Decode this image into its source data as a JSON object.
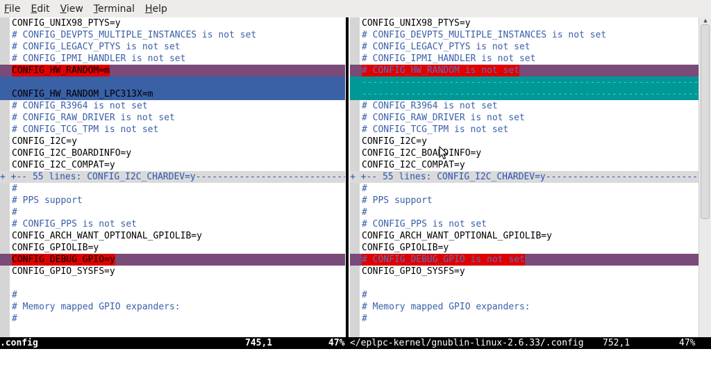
{
  "menubar": {
    "items": [
      {
        "accel": "F",
        "rest": "ile"
      },
      {
        "accel": "E",
        "rest": "dit"
      },
      {
        "accel": "V",
        "rest": "iew"
      },
      {
        "accel": "T",
        "rest": "erminal"
      },
      {
        "accel": "H",
        "rest": "elp"
      }
    ]
  },
  "left": {
    "lines": [
      {
        "text": "CONFIG_UNIX98_PTYS=y",
        "kind": "normal"
      },
      {
        "text": "# CONFIG_DEVPTS_MULTIPLE_INSTANCES is not set",
        "kind": "comment"
      },
      {
        "text": "# CONFIG_LEGACY_PTYS is not set",
        "kind": "comment"
      },
      {
        "text": "# CONFIG_IPMI_HANDLER is not set",
        "kind": "comment"
      },
      {
        "text": "CONFIG_HW_RANDOM=m",
        "kind": "change"
      },
      {
        "text": "",
        "kind": "add"
      },
      {
        "text": "CONFIG_HW_RANDOM_LPC313X=m",
        "kind": "add"
      },
      {
        "text": "# CONFIG_R3964 is not set",
        "kind": "comment"
      },
      {
        "text": "# CONFIG_RAW_DRIVER is not set",
        "kind": "comment"
      },
      {
        "text": "# CONFIG_TCG_TPM is not set",
        "kind": "comment"
      },
      {
        "text": "CONFIG_I2C=y",
        "kind": "normal"
      },
      {
        "text": "CONFIG_I2C_BOARDINFO=y",
        "kind": "normal"
      },
      {
        "text": "CONFIG_I2C_COMPAT=y",
        "kind": "normal"
      },
      {
        "text": "+ +-- 55 lines: CONFIG_I2C_CHARDEV=y---------------------------------",
        "kind": "fold"
      },
      {
        "text": "#",
        "kind": "comment"
      },
      {
        "text": "# PPS support",
        "kind": "comment"
      },
      {
        "text": "#",
        "kind": "comment"
      },
      {
        "text": "# CONFIG_PPS is not set",
        "kind": "comment"
      },
      {
        "text": "CONFIG_ARCH_WANT_OPTIONAL_GPIOLIB=y",
        "kind": "normal"
      },
      {
        "text": "CONFIG_GPIOLIB=y",
        "kind": "normal"
      },
      {
        "text": "CONFIG_DEBUG_GPIO=y",
        "kind": "change"
      },
      {
        "text": "CONFIG_GPIO_SYSFS=y",
        "kind": "normal"
      },
      {
        "text": "",
        "kind": "normal"
      },
      {
        "text": "#",
        "kind": "comment"
      },
      {
        "text": "# Memory mapped GPIO expanders:",
        "kind": "comment"
      },
      {
        "text": "#",
        "kind": "comment"
      }
    ],
    "status": {
      "file": ".config",
      "pos": "745,1",
      "pct": "47%"
    }
  },
  "right": {
    "lines": [
      {
        "text": "CONFIG_UNIX98_PTYS=y",
        "kind": "normal"
      },
      {
        "text": "# CONFIG_DEVPTS_MULTIPLE_INSTANCES is not set",
        "kind": "comment"
      },
      {
        "text": "# CONFIG_LEGACY_PTYS is not set",
        "kind": "comment"
      },
      {
        "text": "# CONFIG_IPMI_HANDLER is not set",
        "kind": "comment"
      },
      {
        "text": "# CONFIG_HW_RANDOM is not set",
        "kind": "change-r"
      },
      {
        "text": "----------------------------------------------------------------------",
        "kind": "del"
      },
      {
        "text": "----------------------------------------------------------------------",
        "kind": "del"
      },
      {
        "text": "# CONFIG_R3964 is not set",
        "kind": "comment"
      },
      {
        "text": "# CONFIG_RAW_DRIVER is not set",
        "kind": "comment"
      },
      {
        "text": "# CONFIG_TCG_TPM is not set",
        "kind": "comment"
      },
      {
        "text": "CONFIG_I2C=y",
        "kind": "normal"
      },
      {
        "text": "CONFIG_I2C_BOARDINFO=y",
        "kind": "normal"
      },
      {
        "text": "CONFIG_I2C_COMPAT=y",
        "kind": "normal"
      },
      {
        "text": "+ +-- 55 lines: CONFIG_I2C_CHARDEV=y---------------------------------",
        "kind": "fold"
      },
      {
        "text": "#",
        "kind": "comment"
      },
      {
        "text": "# PPS support",
        "kind": "comment"
      },
      {
        "text": "#",
        "kind": "comment"
      },
      {
        "text": "# CONFIG_PPS is not set",
        "kind": "comment"
      },
      {
        "text": "CONFIG_ARCH_WANT_OPTIONAL_GPIOLIB=y",
        "kind": "normal"
      },
      {
        "text": "CONFIG_GPIOLIB=y",
        "kind": "normal"
      },
      {
        "text": "# CONFIG_DEBUG_GPIO is not set",
        "kind": "change-r"
      },
      {
        "text": "CONFIG_GPIO_SYSFS=y",
        "kind": "normal"
      },
      {
        "text": "",
        "kind": "normal"
      },
      {
        "text": "#",
        "kind": "comment"
      },
      {
        "text": "# Memory mapped GPIO expanders:",
        "kind": "comment"
      },
      {
        "text": "#",
        "kind": "comment"
      }
    ],
    "status": {
      "file": "</eplpc-kernel/gnublin-linux-2.6.33/.config",
      "pos": "752,1",
      "pct": "47%"
    }
  }
}
